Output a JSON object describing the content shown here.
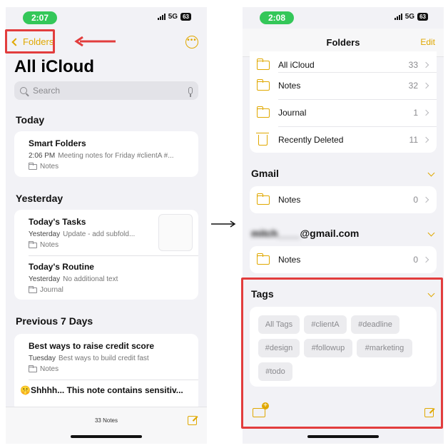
{
  "left": {
    "status": {
      "time": "2:07",
      "network": "5G",
      "battery": "63"
    },
    "nav": {
      "back_label": "Folders",
      "more_icon": "ellipsis-circle-icon"
    },
    "title": "All iCloud",
    "search": {
      "placeholder": "Search"
    },
    "sections": [
      {
        "heading": "Today",
        "notes": [
          {
            "title": "Smart Folders",
            "time": "2:06 PM",
            "preview": "Meeting notes for Friday #clientA #...",
            "folder": "Notes"
          }
        ]
      },
      {
        "heading": "Yesterday",
        "notes": [
          {
            "title": "Today's Tasks",
            "time": "Yesterday",
            "preview": "Update - add subfold...",
            "folder": "Notes"
          },
          {
            "title": "Today's Routine",
            "time": "Yesterday",
            "preview": "No additional text",
            "folder": "Journal"
          }
        ]
      },
      {
        "heading": "Previous 7 Days",
        "notes": [
          {
            "title": "Best ways to raise credit score",
            "time": "Tuesday",
            "preview": "Best ways to build credit fast",
            "folder": "Notes"
          },
          {
            "title": "🤫Shhhh... This note contains sensitiv..."
          }
        ]
      }
    ],
    "bottom": {
      "count": "33 Notes"
    }
  },
  "right": {
    "status": {
      "time": "2:08",
      "network": "5G",
      "battery": "63"
    },
    "header": {
      "title": "Folders",
      "edit_label": "Edit"
    },
    "icloud_folders": [
      {
        "label": "All iCloud",
        "count": "33",
        "icon": "folder-icon"
      },
      {
        "label": "Notes",
        "count": "32",
        "icon": "folder-icon"
      },
      {
        "label": "Journal",
        "count": "1",
        "icon": "folder-icon"
      },
      {
        "label": "Recently Deleted",
        "count": "11",
        "icon": "trash-icon"
      }
    ],
    "gmail": {
      "heading": "Gmail",
      "folder_label": "Notes",
      "folder_count": "0"
    },
    "other_account": {
      "heading_hidden": "mitch____",
      "heading_visible": "@gmail.com",
      "folder_label": "Notes",
      "folder_count": "0"
    },
    "tags": {
      "heading": "Tags",
      "items": [
        "All Tags",
        "#clientA",
        "#deadline",
        "#design",
        "#followup",
        "#marketing",
        "#todo"
      ]
    }
  },
  "colors": {
    "accent": "#e0a800",
    "highlight": "#e23d3d",
    "status_green": "#34c759"
  }
}
